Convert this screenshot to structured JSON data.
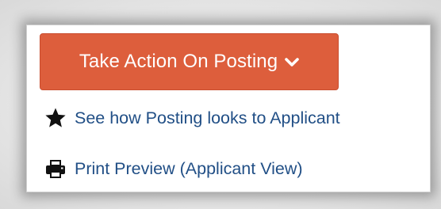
{
  "dropdown": {
    "button_label": "Take Action On Posting",
    "items": [
      {
        "label": "See how Posting looks to Applicant",
        "icon": "star-icon"
      },
      {
        "label": "Print Preview (Applicant View)",
        "icon": "printer-icon"
      }
    ]
  },
  "colors": {
    "button_bg": "#dd5e3c",
    "link": "#214f86"
  }
}
